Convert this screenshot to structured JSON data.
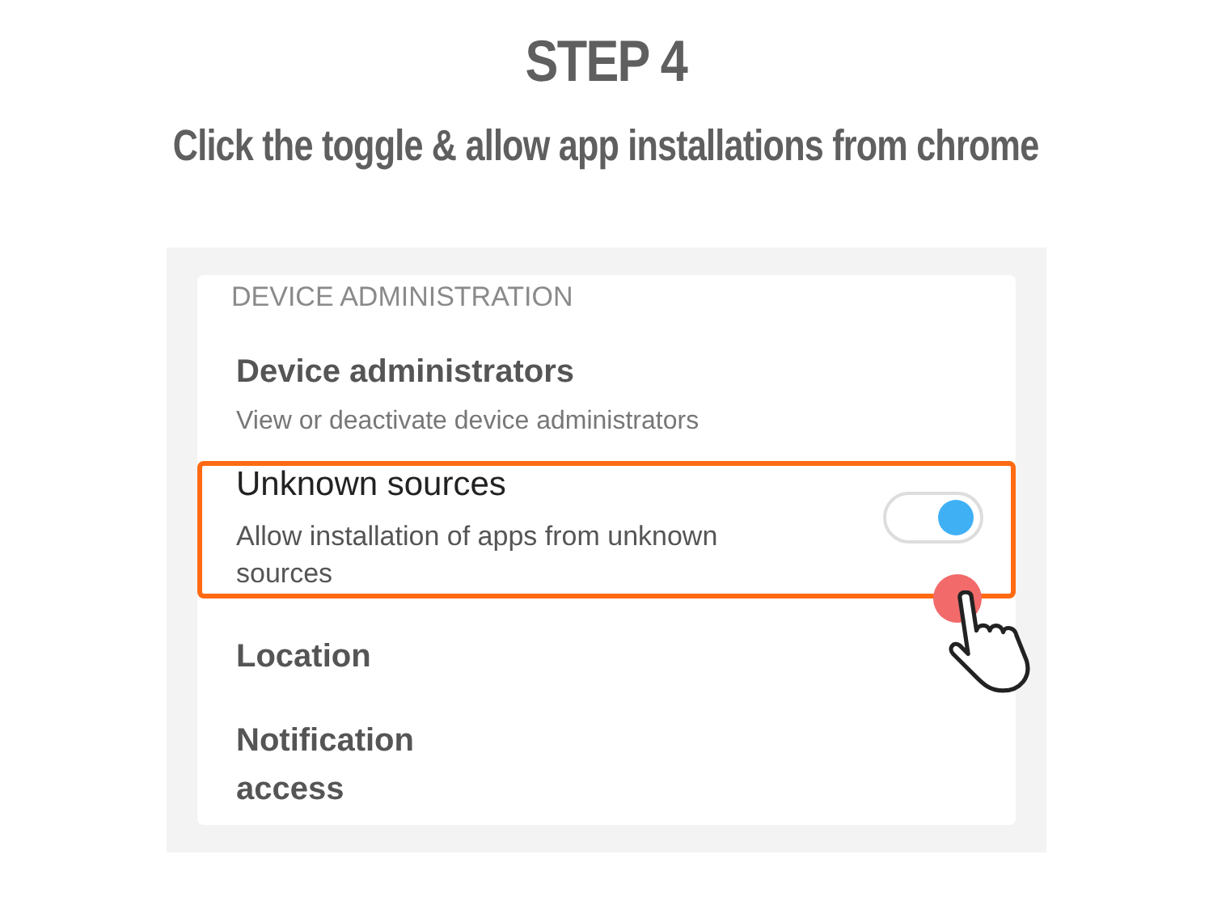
{
  "heading": "STEP 4",
  "instruction": "Click the toggle & allow app installations from chrome",
  "settings": {
    "section_header": "DEVICE ADMINISTRATION",
    "items": [
      {
        "kind": "plain",
        "title": "Device administrators",
        "subtitle": "View or deactivate device administrators",
        "highlighted": false
      },
      {
        "kind": "toggle",
        "title": "Unknown sources",
        "subtitle": "Allow installation of apps from unknown sources",
        "highlighted": true,
        "on": true
      },
      {
        "kind": "plain",
        "title": "Location",
        "highlighted": false
      },
      {
        "kind": "plain",
        "title": "Notification access",
        "highlighted": false
      }
    ]
  }
}
